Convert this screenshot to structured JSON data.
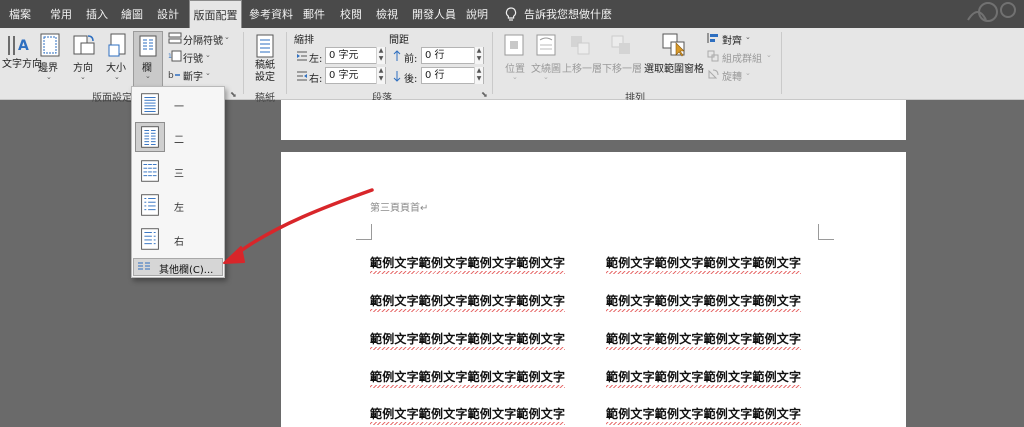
{
  "tabs": [
    {
      "label": "檔案"
    },
    {
      "label": "常用"
    },
    {
      "label": "插入"
    },
    {
      "label": "繪圖"
    },
    {
      "label": "設計"
    },
    {
      "label": "版面配置"
    },
    {
      "label": "參考資料"
    },
    {
      "label": "郵件"
    },
    {
      "label": "校閱"
    },
    {
      "label": "檢視"
    },
    {
      "label": "開發人員"
    },
    {
      "label": "說明"
    }
  ],
  "tell_me": "告訴我您想做什麼",
  "page_setup": {
    "group_label": "版面設定",
    "text_direction": "文字方向",
    "margins": "邊界",
    "orientation": "方向",
    "size": "大小",
    "columns": "欄",
    "breaks": "分隔符號",
    "line_numbers": "行號",
    "hyphenation": "斷字"
  },
  "manuscript": {
    "group_label": "稿紙",
    "label": "稿紙設定"
  },
  "paragraph": {
    "group_label": "段落",
    "indent_header": "縮排",
    "spacing_header": "間距",
    "left_label": "左:",
    "left_value": "0 字元",
    "right_label": "右:",
    "right_value": "0 字元",
    "before_label": "前:",
    "before_value": "0 行",
    "after_label": "後:",
    "after_value": "0 行"
  },
  "arrange": {
    "group_label": "排列",
    "position": "位置",
    "wrap_text": "文繞圖",
    "bring_forward": "上移一層",
    "send_backward": "下移一層",
    "selection_pane": "選取範圍窗格",
    "align": "對齊",
    "group": "組成群組",
    "rotate": "旋轉"
  },
  "columns_menu": {
    "items": [
      {
        "label": "一"
      },
      {
        "label": "二"
      },
      {
        "label": "三"
      },
      {
        "label": "左"
      },
      {
        "label": "右"
      }
    ],
    "more": "其他欄(C)..."
  },
  "document": {
    "header_text": "第三頁頁首↵",
    "line_text": "範例文字範例文字範例文字範例文字"
  },
  "colors": {
    "tab_bg": "#4a4a4a",
    "ribbon_bg": "#e6e6e6",
    "canvas_bg": "#6a6a6a",
    "arrow": "#d8262a",
    "accent_icon": "#2e6fc0"
  }
}
